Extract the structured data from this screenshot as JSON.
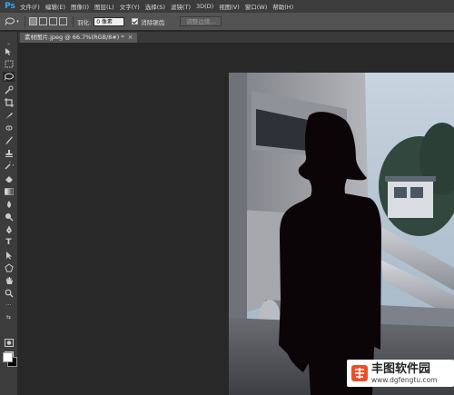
{
  "app": {
    "logo": "Ps"
  },
  "menu": [
    "文件(F)",
    "编辑(E)",
    "图像(I)",
    "图层(L)",
    "文字(Y)",
    "选择(S)",
    "滤镜(T)",
    "3D(D)",
    "视图(V)",
    "窗口(W)",
    "帮助(H)"
  ],
  "options": {
    "feather_label": "羽化:",
    "feather_value": "0 像素",
    "antialias_label": "消除锯齿",
    "antialias_checked": true,
    "refine_edge_label": "调整边缘..."
  },
  "document": {
    "tab_title": "素材图片.jpeg @ 66.7%(RGB/8#) *",
    "close": "×"
  },
  "colors": {
    "foreground": "#ffffff",
    "background": "#000000",
    "accent": "#31a8ff"
  },
  "watermark": {
    "name": "丰图软件园",
    "url": "www.dgfengtu.com"
  },
  "tools": [
    "move-icon",
    "marquee-icon",
    "lasso-icon",
    "quick-select-icon",
    "crop-icon",
    "eyedropper-icon",
    "healing-icon",
    "brush-icon",
    "clone-stamp-icon",
    "history-brush-icon",
    "eraser-icon",
    "gradient-icon",
    "blur-icon",
    "dodge-icon",
    "pen-icon",
    "type-icon",
    "path-select-icon",
    "shape-icon",
    "hand-icon",
    "zoom-icon"
  ]
}
